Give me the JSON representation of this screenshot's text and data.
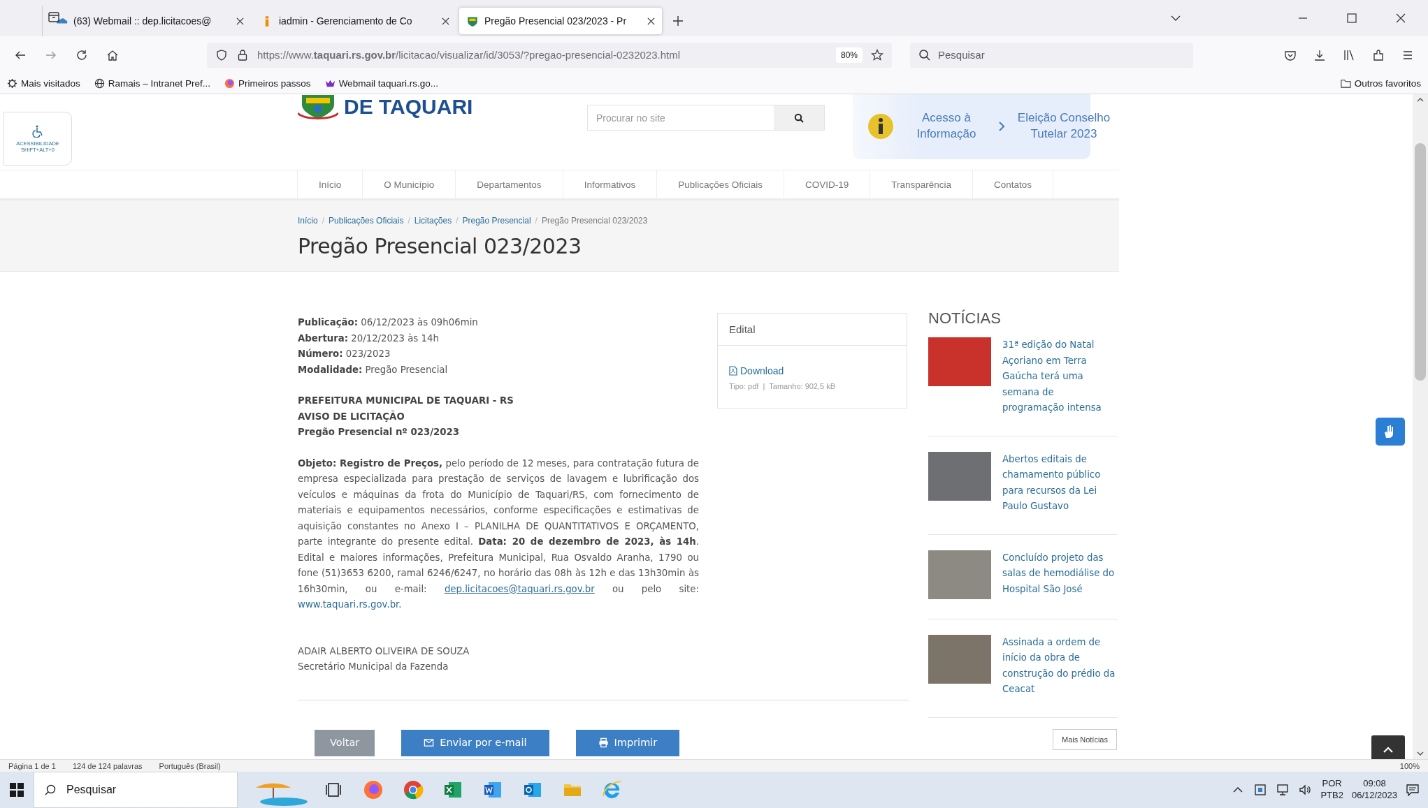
{
  "browser": {
    "tabs": [
      {
        "title": "(63) Webmail :: dep.licitacoes@",
        "selected": false,
        "kind": "mail"
      },
      {
        "title": "iadmin - Gerenciamento de Co",
        "selected": false,
        "kind": "admin"
      },
      {
        "title": "Pregão Presencial 023/2023 - Pr",
        "selected": true,
        "kind": "crest"
      }
    ],
    "url": "https://www.**taquari.rs.gov.br**/licitacao/visualizar/id/3053/?pregao-presencial-0232023.html",
    "zoom": "80%",
    "search": {
      "placeholder": "Pesquisar"
    },
    "bookmarks": [
      {
        "label": "Mais visitados",
        "kind": "gear"
      },
      {
        "label": "Ramais – Intranet Pref...",
        "kind": "globe"
      },
      {
        "label": "Primeiros passos",
        "kind": "firefox"
      },
      {
        "label": "Webmail taquari.rs.go...",
        "kind": "crown"
      }
    ],
    "other_bookmarks": "Outros favoritos"
  },
  "site": {
    "logo": "DE TAQUARI",
    "accessibility": {
      "label": "ACESSIBILIDADE",
      "shortcut": "SHIFT+ALT+0"
    },
    "search": {
      "placeholder": "Procurar no site"
    },
    "quick_links": [
      {
        "label": "Acesso à Informação",
        "kind": "info"
      },
      {
        "label": "Eleição Conselho Tutelar 2023",
        "kind": "chevron"
      }
    ],
    "menu": [
      "Início",
      "O Município",
      "Departamentos",
      "Informativos",
      "Publicações Oficiais",
      "COVID-19",
      "Transparência",
      "Contatos"
    ],
    "breadcrumb": {
      "separator": "/",
      "links": [
        "Início",
        "Publicações Oficiais",
        "Licitações",
        "Pregão Presencial"
      ],
      "current": "Pregão Presencial 023/2023"
    },
    "title": "Pregão Presencial 023/2023",
    "details": [
      "**Publicação:** 06/12/2023 às 09h06min",
      "**Abertura:** 20/12/2023 às 14h",
      "**Número:** 023/2023",
      "**Modalidade:** Pregão Presencial"
    ],
    "headings": [
      "PREFEITURA MUNICIPAL DE TAQUARI - RS",
      "AVISO DE LICITAÇÃO",
      "Pregão Presencial nº 023/2023"
    ],
    "body": {
      "text": "**Objeto: Registro de Preços,** pelo período de 12 meses, para contratação futura de empresa especializada para prestação de serviços de lavagem e lubrificação dos veículos e máquinas da frota do Município de Taquari/RS, com fornecimento de materiais e equipamentos necessários, conforme especificações e estimativas de aquisição constantes no Anexo I – PLANILHA DE QUANTITATIVOS E ORÇAMENTO, parte integrante do presente edital. **Data: 20 de dezembro de 2023, às 14h**. Edital e maiores informações, Prefeitura Municipal, Rua Osvaldo Aranha, 1790 ou fone (51)3653 6200, ramal 6246/6247, no horário das 08h às 12h e das 13h30min às 16h30min, ou e-mail:",
      "email": "dep.licitacoes@taquari.rs.gov.br",
      "middle": "ou pelo site:",
      "site": "www.taquari.rs.gov.br",
      "end": "."
    },
    "signature": [
      "ADAIR ALBERTO OLIVEIRA DE SOUZA",
      "Secretário Municipal da Fazenda"
    ],
    "actions": [
      {
        "label": "Voltar",
        "kind": "plain",
        "disabled": true
      },
      {
        "label": "Enviar por e-mail",
        "kind": "email",
        "disabled": false
      },
      {
        "label": "Imprimir",
        "kind": "print",
        "disabled": false
      }
    ],
    "edital": {
      "title": "Edital",
      "download": "Download",
      "type": "Tipo: pdf",
      "separator": "|",
      "size": "Tamanho: 902,5 kB"
    },
    "news": {
      "heading": "NOTÍCIAS",
      "items": [
        {
          "title": "31ª edição do Natal Açoriano em Terra Gaúcha terá uma semana de programação intensa"
        },
        {
          "title": "Abertos editais de chamamento público para recursos da Lei Paulo Gustavo"
        },
        {
          "title": "Concluído projeto das salas de hemodiálise do Hospital São José"
        },
        {
          "title": "Assinada a ordem de início da obra de construção do prédio da Ceacat"
        }
      ],
      "more": "Mais Notícias"
    }
  },
  "word_status": {
    "items": [
      "Página 1 de 1",
      "124 de 124 palavras",
      "Português (Brasil)"
    ],
    "zoom": "100%"
  },
  "taskbar": {
    "search": {
      "placeholder": "Pesquisar"
    },
    "language": "POR",
    "layout": "PTB2",
    "time": "09:08",
    "date": "06/12/2023"
  }
}
